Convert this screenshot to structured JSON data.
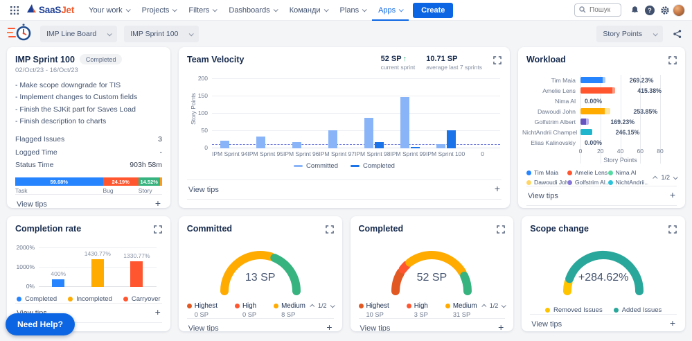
{
  "nav": {
    "brand_primary": "SaaS",
    "brand_secondary": "Jet",
    "items": [
      "Your work",
      "Projects",
      "Filters",
      "Dashboards",
      "Команди",
      "Plans",
      "Apps"
    ],
    "active_item": "Apps",
    "create_label": "Create",
    "search_placeholder": "Пошук"
  },
  "toolbar": {
    "board_select": "IMP Line Board",
    "sprint_select": "IMP Sprint 100",
    "unit_select": "Story Points"
  },
  "common": {
    "view_tips": "View tips"
  },
  "sprint_card": {
    "title": "IMP Sprint 100",
    "badge": "Completed",
    "dates": "02/Oct/23 - 16/Oct/23",
    "goals": [
      "- Make scope downgrade for TIS",
      "- Implement changes to Custom fields",
      "- Finish the SJKit part for Saves Load",
      "- Finish description to charts"
    ],
    "stats": [
      {
        "label": "Flagged Issues",
        "value": "3"
      },
      {
        "label": "Logged Time",
        "value": "-"
      },
      {
        "label": "Status Time",
        "value": "903h 58m"
      }
    ],
    "breakdown": [
      {
        "label": "Task",
        "percent": 59.68,
        "text": "59.68%",
        "color": "#2684FF"
      },
      {
        "label": "Bug",
        "percent": 24.19,
        "text": "24.19%",
        "color": "#FF5630"
      },
      {
        "label": "Story",
        "percent": 14.52,
        "text": "14.52%",
        "color": "#36B37E"
      },
      {
        "label": "",
        "percent": 1.61,
        "text": "",
        "color": "#FF991F"
      }
    ]
  },
  "velocity_card": {
    "title": "Team Velocity",
    "current": {
      "value": "52 SP",
      "caption": "current sprint"
    },
    "average": {
      "value": "10.71 SP",
      "caption": "average last 7 sprints"
    },
    "chart_data": {
      "type": "bar",
      "ylabel": "Story Points",
      "ymax": 200,
      "yticks": [
        0,
        50,
        100,
        150,
        200
      ],
      "categories": [
        "IPM Sprint 94",
        "IPM Sprint 95",
        "IPM Sprint 96",
        "IPM Sprint 97",
        "IPM Sprint 98",
        "IPM Sprint 99",
        "IPM Sprint 100",
        "0"
      ],
      "series": [
        {
          "name": "Committed",
          "color": "#8AB4F8",
          "values": [
            22,
            35,
            18,
            53,
            88,
            148,
            13,
            0
          ]
        },
        {
          "name": "Completed",
          "color": "#1A73E8",
          "values": [
            0,
            0,
            0,
            0,
            18,
            5,
            52,
            0
          ]
        }
      ],
      "average_line": 10.71,
      "average_line_color": "#6E7BD9"
    }
  },
  "workload_card": {
    "title": "Workload",
    "chart_data": {
      "type": "bar-horizontal",
      "xlabel": "Story Points",
      "xmax": 80,
      "xticks": [
        0,
        20,
        40,
        60,
        80
      ],
      "rows": [
        {
          "name": "Tim Maia",
          "value": 40,
          "tail": 5,
          "percent": "269.23%",
          "color": "#2684FF",
          "tail_color": "#A9C8F9"
        },
        {
          "name": "Amelie Lens",
          "value": 48,
          "tail": 5,
          "percent": "415.38%",
          "color": "#FF5630",
          "tail_color": "#FF9C85"
        },
        {
          "name": "Nima Al",
          "value": 0,
          "tail": 0,
          "percent": "0.00%",
          "color": "#57D9A3",
          "tail_color": ""
        },
        {
          "name": "Dawoudi John",
          "value": 40,
          "tail": 9,
          "percent": "253.85%",
          "color": "#FFAB00",
          "tail_color": "#FFE49E"
        },
        {
          "name": "Golfstrim Albert",
          "value": 17,
          "tail": 9,
          "percent": "169.23%",
          "color": "#6554C0",
          "tail_color": "#B9AEEE"
        },
        {
          "name": "NichtAndrii Champel",
          "value": 31,
          "tail": 0,
          "percent": "246.15%",
          "color": "#1FB6CD",
          "tail_color": ""
        },
        {
          "name": "Elias Kalinovskiy",
          "value": 0,
          "tail": 0,
          "percent": "0.00%",
          "color": "#2684FF",
          "tail_color": ""
        }
      ]
    },
    "legend": [
      {
        "label": "Tim Maia",
        "color": "#2684FF"
      },
      {
        "label": "Amelie Lens",
        "color": "#FF5630"
      },
      {
        "label": "Nima Al",
        "color": "#57D9A3"
      },
      {
        "label": "Dawoudi John",
        "color": "#FFD666"
      },
      {
        "label": "Golfstrim Al...",
        "color": "#8777D9"
      },
      {
        "label": "NichtAndrii...",
        "color": "#2CC3DA"
      }
    ],
    "pagination": "1/2"
  },
  "completion_card": {
    "title": "Completion rate",
    "chart_data": {
      "type": "bar",
      "ymax": 2000,
      "yticks": [
        "0%",
        "1000%",
        "2000%"
      ],
      "categories": [
        "Completed",
        "Incompleted",
        "Carryover"
      ],
      "values": [
        400,
        1430.77,
        1330.77
      ],
      "labels": [
        "400%",
        "1430.77%",
        "1330.77%"
      ],
      "colors": [
        "#2684FF",
        "#FFAB00",
        "#FF5630"
      ]
    },
    "legend": [
      {
        "label": "Completed",
        "color": "#2684FF"
      },
      {
        "label": "Incompleted",
        "color": "#FFAB00"
      },
      {
        "label": "Carryover",
        "color": "#FF5630"
      }
    ]
  },
  "committed_card": {
    "title": "Committed",
    "center": "13 SP",
    "gauge": [
      {
        "color": "#FFAB00",
        "frac": 0.615
      },
      {
        "color": "#36B37E",
        "frac": 0.385
      }
    ],
    "legend": [
      {
        "label": "Highest",
        "value": "0 SP",
        "color": "#E25822"
      },
      {
        "label": "High",
        "value": "0 SP",
        "color": "#FF5630"
      },
      {
        "label": "Medium",
        "value": "8 SP",
        "color": "#FFAB00"
      }
    ],
    "pagination": "1/2"
  },
  "completed_card": {
    "title": "Completed",
    "center": "52 SP",
    "gauge": [
      {
        "color": "#E25822",
        "frac": 0.192
      },
      {
        "color": "#FF5630",
        "frac": 0.058
      },
      {
        "color": "#FFAB00",
        "frac": 0.596
      },
      {
        "color": "#36B37E",
        "frac": 0.154
      }
    ],
    "legend": [
      {
        "label": "Highest",
        "value": "10 SP",
        "color": "#E25822"
      },
      {
        "label": "High",
        "value": "3 SP",
        "color": "#FF5630"
      },
      {
        "label": "Medium",
        "value": "31 SP",
        "color": "#FFAB00"
      }
    ],
    "pagination": "1/2"
  },
  "scope_card": {
    "title": "Scope change",
    "center": "+284.62%",
    "gauge": [
      {
        "color": "#FFC400",
        "frac": 0.08
      },
      {
        "color": "#2AA79B",
        "frac": 0.92
      }
    ],
    "legend": [
      {
        "label": "Removed Issues",
        "color": "#FFC400"
      },
      {
        "label": "Added Issues",
        "color": "#2AA79B"
      }
    ]
  },
  "help_button": "Need Help?"
}
